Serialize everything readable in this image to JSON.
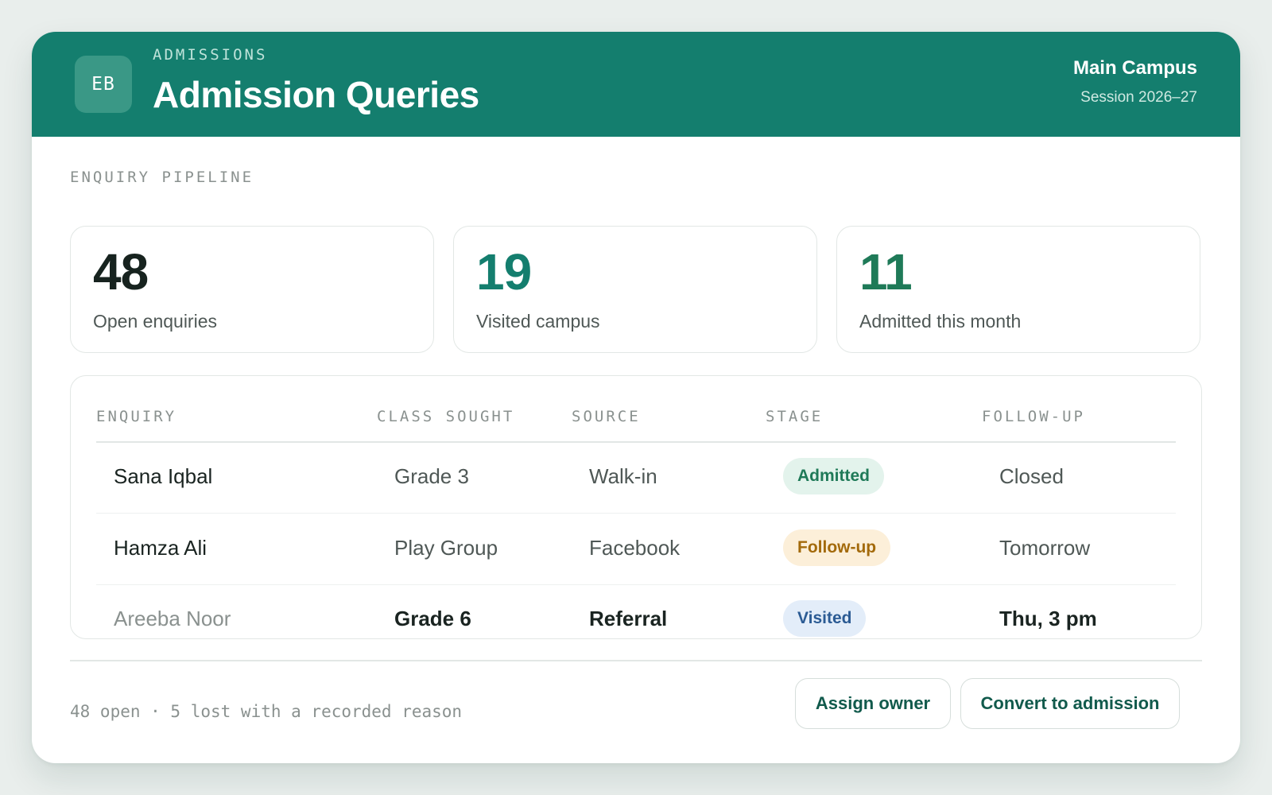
{
  "header": {
    "logo_initials": "EB",
    "eyebrow": "ADMISSIONS",
    "title": "Admission Queries",
    "campus": "Main Campus",
    "session": "Session 2026–27",
    "background_color": "#147e6e"
  },
  "pipeline": {
    "label": "ENQUIRY PIPELINE",
    "stats": [
      {
        "value": "48",
        "label": "Open enquiries",
        "color": "#17231f"
      },
      {
        "value": "19",
        "label": "Visited campus",
        "color": "#147e6e"
      },
      {
        "value": "11",
        "label": "Admitted this month",
        "color": "#1f7a58"
      }
    ]
  },
  "table": {
    "columns": [
      "ENQUIRY",
      "CLASS SOUGHT",
      "SOURCE",
      "STAGE",
      "FOLLOW-UP"
    ],
    "rows": [
      {
        "name": "Sana Iqbal",
        "class": "Grade 3",
        "source": "Walk-in",
        "stage": "Admitted",
        "followup": "Closed"
      },
      {
        "name": "Hamza Ali",
        "class": "Play Group",
        "source": "Facebook",
        "stage": "Follow-up",
        "followup": "Tomorrow"
      },
      {
        "name": "Areeba Noor",
        "class": "Grade 6",
        "source": "Referral",
        "stage": "Visited",
        "followup": "Thu, 3 pm"
      }
    ]
  },
  "footer": {
    "note": "48 open · 5 lost with a recorded reason",
    "assign_label": "Assign owner",
    "convert_label": "Convert to admission"
  }
}
